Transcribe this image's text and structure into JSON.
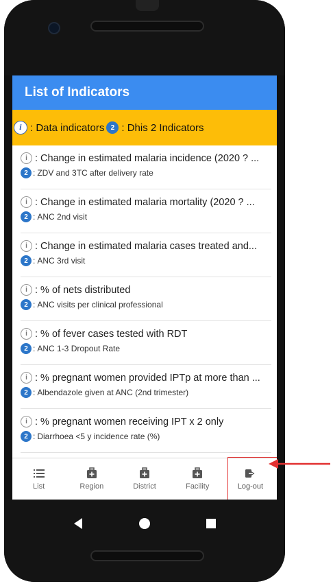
{
  "appbar": {
    "title": "List of Indicators"
  },
  "legend": {
    "data_label": ": Data indicators",
    "dhis_label": ": Dhis 2 Indicators",
    "data_icon": "i",
    "dhis_icon": "2"
  },
  "items": [
    {
      "indicator": "Change in estimated malaria incidence (2020 ? ...",
      "dhis": "ZDV and 3TC after delivery rate"
    },
    {
      "indicator": "Change in estimated malaria mortality (2020 ? ...",
      "dhis": "ANC 2nd visit"
    },
    {
      "indicator": "Change in estimated malaria cases treated and...",
      "dhis": "ANC 3rd visit"
    },
    {
      "indicator": "% of nets distributed",
      "dhis": "ANC visits per clinical professional"
    },
    {
      "indicator": "% of fever cases tested with RDT",
      "dhis": "ANC 1-3 Dropout Rate"
    },
    {
      "indicator": "% pregnant women provided IPTp at more than ...",
      "dhis": "Albendazole given at ANC (2nd trimester)"
    },
    {
      "indicator": "% pregnant women receiving IPT x 2 only",
      "dhis": "Diarrhoea <5 y incidence rate (%)"
    }
  ],
  "bottom_nav": {
    "list": "List",
    "region": "Region",
    "district": "District",
    "facility": "Facility",
    "logout": "Log-out"
  },
  "colors": {
    "appbar": "#3b8cf0",
    "legend_bg": "#fdbd08",
    "highlight": "#e23030"
  }
}
